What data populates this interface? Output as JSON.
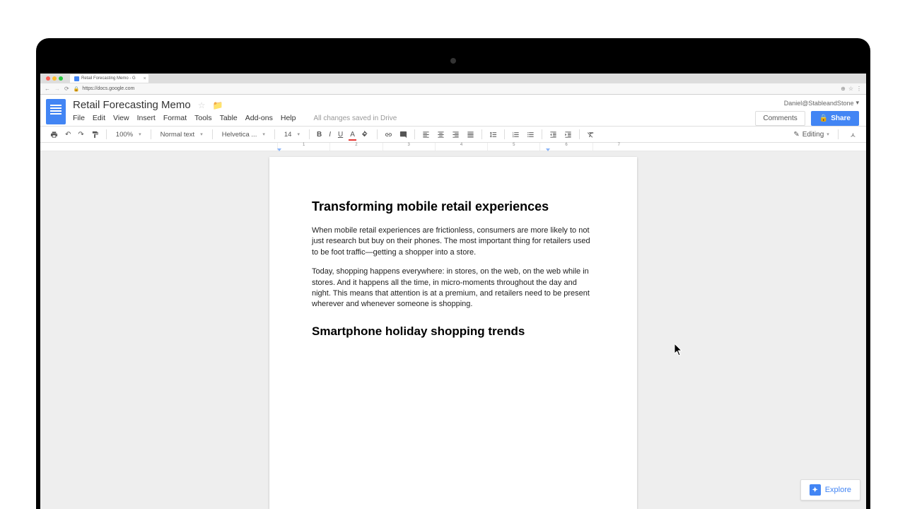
{
  "browser": {
    "tab_title": "Retail Forecasting Memo - G",
    "url": "https://docs.google.com"
  },
  "header": {
    "doc_title": "Retail Forecasting Memo",
    "user_email": "Daniel@StableandStone",
    "comments_label": "Comments",
    "share_label": "Share"
  },
  "menu": {
    "file": "File",
    "edit": "Edit",
    "view": "View",
    "insert": "Insert",
    "format": "Format",
    "tools": "Tools",
    "table": "Table",
    "addons": "Add-ons",
    "help": "Help",
    "save_status": "All changes saved in Drive"
  },
  "toolbar": {
    "zoom": "100%",
    "style": "Normal text",
    "font": "Helvetica ...",
    "size": "14",
    "editing_mode": "Editing"
  },
  "ruler": {
    "marks": [
      "1",
      "2",
      "3",
      "4",
      "5",
      "6",
      "7"
    ]
  },
  "document": {
    "heading1": "Transforming mobile retail experiences",
    "para1": "When mobile retail experiences are frictionless, consumers are more likely to not just research but buy on their phones. The most important thing for retailers used to be foot traffic—getting a shopper into a store.",
    "para2": "Today, shopping happens everywhere: in stores, on the web, on the web while in stores. And it happens all the time, in micro-moments throughout the day and night. This means that attention is at a premium, and retailers need to be present wherever and whenever someone is shopping.",
    "heading2": "Smartphone holiday shopping trends"
  },
  "explore": {
    "label": "Explore"
  }
}
